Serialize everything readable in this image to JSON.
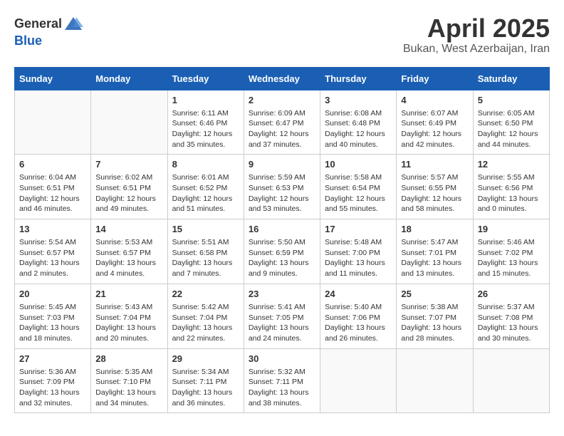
{
  "header": {
    "logo_general": "General",
    "logo_blue": "Blue",
    "month": "April 2025",
    "location": "Bukan, West Azerbaijan, Iran"
  },
  "weekdays": [
    "Sunday",
    "Monday",
    "Tuesday",
    "Wednesday",
    "Thursday",
    "Friday",
    "Saturday"
  ],
  "weeks": [
    [
      {
        "day": "",
        "sunrise": "",
        "sunset": "",
        "daylight": ""
      },
      {
        "day": "",
        "sunrise": "",
        "sunset": "",
        "daylight": ""
      },
      {
        "day": "1",
        "sunrise": "Sunrise: 6:11 AM",
        "sunset": "Sunset: 6:46 PM",
        "daylight": "Daylight: 12 hours and 35 minutes."
      },
      {
        "day": "2",
        "sunrise": "Sunrise: 6:09 AM",
        "sunset": "Sunset: 6:47 PM",
        "daylight": "Daylight: 12 hours and 37 minutes."
      },
      {
        "day": "3",
        "sunrise": "Sunrise: 6:08 AM",
        "sunset": "Sunset: 6:48 PM",
        "daylight": "Daylight: 12 hours and 40 minutes."
      },
      {
        "day": "4",
        "sunrise": "Sunrise: 6:07 AM",
        "sunset": "Sunset: 6:49 PM",
        "daylight": "Daylight: 12 hours and 42 minutes."
      },
      {
        "day": "5",
        "sunrise": "Sunrise: 6:05 AM",
        "sunset": "Sunset: 6:50 PM",
        "daylight": "Daylight: 12 hours and 44 minutes."
      }
    ],
    [
      {
        "day": "6",
        "sunrise": "Sunrise: 6:04 AM",
        "sunset": "Sunset: 6:51 PM",
        "daylight": "Daylight: 12 hours and 46 minutes."
      },
      {
        "day": "7",
        "sunrise": "Sunrise: 6:02 AM",
        "sunset": "Sunset: 6:51 PM",
        "daylight": "Daylight: 12 hours and 49 minutes."
      },
      {
        "day": "8",
        "sunrise": "Sunrise: 6:01 AM",
        "sunset": "Sunset: 6:52 PM",
        "daylight": "Daylight: 12 hours and 51 minutes."
      },
      {
        "day": "9",
        "sunrise": "Sunrise: 5:59 AM",
        "sunset": "Sunset: 6:53 PM",
        "daylight": "Daylight: 12 hours and 53 minutes."
      },
      {
        "day": "10",
        "sunrise": "Sunrise: 5:58 AM",
        "sunset": "Sunset: 6:54 PM",
        "daylight": "Daylight: 12 hours and 55 minutes."
      },
      {
        "day": "11",
        "sunrise": "Sunrise: 5:57 AM",
        "sunset": "Sunset: 6:55 PM",
        "daylight": "Daylight: 12 hours and 58 minutes."
      },
      {
        "day": "12",
        "sunrise": "Sunrise: 5:55 AM",
        "sunset": "Sunset: 6:56 PM",
        "daylight": "Daylight: 13 hours and 0 minutes."
      }
    ],
    [
      {
        "day": "13",
        "sunrise": "Sunrise: 5:54 AM",
        "sunset": "Sunset: 6:57 PM",
        "daylight": "Daylight: 13 hours and 2 minutes."
      },
      {
        "day": "14",
        "sunrise": "Sunrise: 5:53 AM",
        "sunset": "Sunset: 6:57 PM",
        "daylight": "Daylight: 13 hours and 4 minutes."
      },
      {
        "day": "15",
        "sunrise": "Sunrise: 5:51 AM",
        "sunset": "Sunset: 6:58 PM",
        "daylight": "Daylight: 13 hours and 7 minutes."
      },
      {
        "day": "16",
        "sunrise": "Sunrise: 5:50 AM",
        "sunset": "Sunset: 6:59 PM",
        "daylight": "Daylight: 13 hours and 9 minutes."
      },
      {
        "day": "17",
        "sunrise": "Sunrise: 5:48 AM",
        "sunset": "Sunset: 7:00 PM",
        "daylight": "Daylight: 13 hours and 11 minutes."
      },
      {
        "day": "18",
        "sunrise": "Sunrise: 5:47 AM",
        "sunset": "Sunset: 7:01 PM",
        "daylight": "Daylight: 13 hours and 13 minutes."
      },
      {
        "day": "19",
        "sunrise": "Sunrise: 5:46 AM",
        "sunset": "Sunset: 7:02 PM",
        "daylight": "Daylight: 13 hours and 15 minutes."
      }
    ],
    [
      {
        "day": "20",
        "sunrise": "Sunrise: 5:45 AM",
        "sunset": "Sunset: 7:03 PM",
        "daylight": "Daylight: 13 hours and 18 minutes."
      },
      {
        "day": "21",
        "sunrise": "Sunrise: 5:43 AM",
        "sunset": "Sunset: 7:04 PM",
        "daylight": "Daylight: 13 hours and 20 minutes."
      },
      {
        "day": "22",
        "sunrise": "Sunrise: 5:42 AM",
        "sunset": "Sunset: 7:04 PM",
        "daylight": "Daylight: 13 hours and 22 minutes."
      },
      {
        "day": "23",
        "sunrise": "Sunrise: 5:41 AM",
        "sunset": "Sunset: 7:05 PM",
        "daylight": "Daylight: 13 hours and 24 minutes."
      },
      {
        "day": "24",
        "sunrise": "Sunrise: 5:40 AM",
        "sunset": "Sunset: 7:06 PM",
        "daylight": "Daylight: 13 hours and 26 minutes."
      },
      {
        "day": "25",
        "sunrise": "Sunrise: 5:38 AM",
        "sunset": "Sunset: 7:07 PM",
        "daylight": "Daylight: 13 hours and 28 minutes."
      },
      {
        "day": "26",
        "sunrise": "Sunrise: 5:37 AM",
        "sunset": "Sunset: 7:08 PM",
        "daylight": "Daylight: 13 hours and 30 minutes."
      }
    ],
    [
      {
        "day": "27",
        "sunrise": "Sunrise: 5:36 AM",
        "sunset": "Sunset: 7:09 PM",
        "daylight": "Daylight: 13 hours and 32 minutes."
      },
      {
        "day": "28",
        "sunrise": "Sunrise: 5:35 AM",
        "sunset": "Sunset: 7:10 PM",
        "daylight": "Daylight: 13 hours and 34 minutes."
      },
      {
        "day": "29",
        "sunrise": "Sunrise: 5:34 AM",
        "sunset": "Sunset: 7:11 PM",
        "daylight": "Daylight: 13 hours and 36 minutes."
      },
      {
        "day": "30",
        "sunrise": "Sunrise: 5:32 AM",
        "sunset": "Sunset: 7:11 PM",
        "daylight": "Daylight: 13 hours and 38 minutes."
      },
      {
        "day": "",
        "sunrise": "",
        "sunset": "",
        "daylight": ""
      },
      {
        "day": "",
        "sunrise": "",
        "sunset": "",
        "daylight": ""
      },
      {
        "day": "",
        "sunrise": "",
        "sunset": "",
        "daylight": ""
      }
    ]
  ]
}
